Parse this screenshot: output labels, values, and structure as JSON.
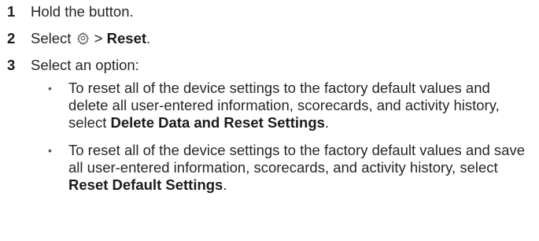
{
  "steps": [
    {
      "number": "1",
      "text": "Hold the button."
    },
    {
      "number": "2",
      "prefix": "Select",
      "separator": ">",
      "bold": "Reset",
      "suffix": ".",
      "icon": "gear-icon"
    },
    {
      "number": "3",
      "text": "Select an option:"
    }
  ],
  "options": [
    {
      "bullet": "•",
      "text": "To reset all of the device settings to the factory default values and delete all user-entered information, scorecards, and activity history, select",
      "bold": "Delete Data and Reset Settings",
      "suffix": "."
    },
    {
      "bullet": "•",
      "text": "To reset all of the device settings to the factory default values and save all user-entered information, scorecards, and activity history, select",
      "bold": "Reset Default Settings",
      "suffix": "."
    }
  ]
}
